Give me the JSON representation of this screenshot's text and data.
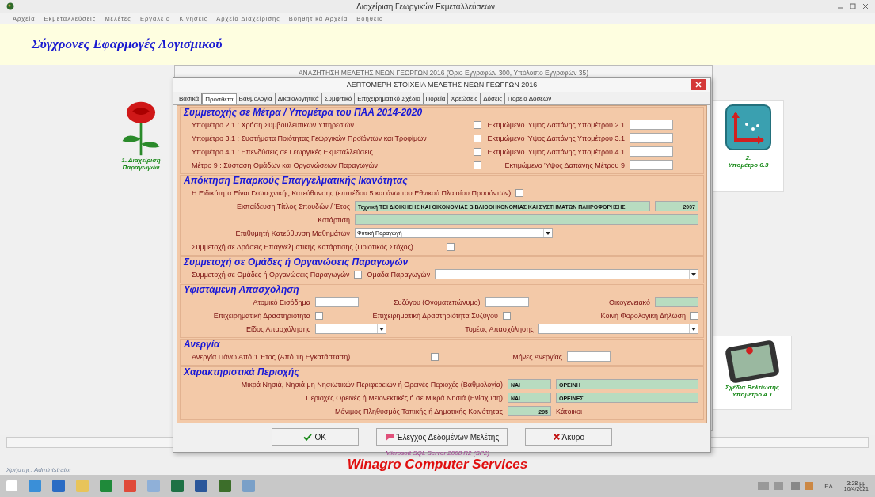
{
  "app": {
    "title": "Διαχείριση Γεωργικών Εκμεταλλεύσεων",
    "menu": [
      "Αρχεία",
      "Εκμεταλλεύσεις",
      "Μελέτες",
      "Εργαλεία",
      "Κινήσεις",
      "Αρχεία Διαχείρισης",
      "Βοηθητικά Αρχεία",
      "Βοήθεια"
    ],
    "brand": "Σύγχρονες Εφαρμογές Λογισμικού"
  },
  "cards": [
    {
      "kind": "rose",
      "label": "1. Διαχείριση",
      "sublabel": "Παραγωγών"
    },
    {
      "kind": "chart",
      "label": "2.",
      "sublabel": "Υπομέτρο 6.3"
    },
    {
      "kind": "phone",
      "label": "Σχέδια Βελτίωσης",
      "sublabel": "Υπομέτρο 4.1"
    }
  ],
  "background_window": {
    "title": "ΑΝΑΖΗΤΗΣΗ ΜΕΛΕΤΗΣ ΝΕΩΝ ΓΕΩΡΓΩΝ 2016 (Όριο Εγγραφών 300, Υπόλοιπο Εγγραφών 35)"
  },
  "dialog": {
    "title": "ΛΕΠΤΟΜΕΡΗ ΣΤΟΙΧΕΙΑ ΜΕΛΕΤΗΣ ΝΕΩΝ ΓΕΩΡΓΩΝ 2016",
    "tabs": [
      {
        "label": "Βασικά",
        "selected": false
      },
      {
        "label": "Πρόσθετα",
        "selected": true
      },
      {
        "label": "Βαθμολογία",
        "selected": false
      },
      {
        "label": "Δικαιολογητικά",
        "selected": false
      },
      {
        "label": "Συμφ/τικό",
        "selected": false
      },
      {
        "label": "Επιχειρηματικό Σχέδιο",
        "selected": false
      },
      {
        "label": "Πορεία",
        "selected": false
      },
      {
        "label": "Χρεώσεις",
        "selected": false
      },
      {
        "label": "Δόσεις",
        "selected": false
      },
      {
        "label": "Πορεία Δόσεων",
        "selected": false
      }
    ],
    "measures": {
      "title": "Συμμετοχής σε Μέτρα / Υπομέτρα του ΠΑΑ 2014-2020",
      "items": [
        {
          "label": "Υπομέτρο 2.1 : Χρήση Συμβουλευτικών Υπηρεσιών",
          "checked": false,
          "cost_label": "Εκτιμώμενο Ύψος Δαπάνης Υπομέτρου 2.1"
        },
        {
          "label": "Υπομέτρο 3.1 : Συστήματα Ποιότητας Γεωργικών Προϊόντων και Τροφίμων",
          "checked": false,
          "cost_label": "Εκτιμώμενο Ύψος Δαπάνης Υπομέτρου 3.1"
        },
        {
          "label": "Υπομέτρο 4.1 : Επενδύσεις σε Γεωργικές Εκμεταλλεύσεις",
          "checked": false,
          "cost_label": "Εκτιμώμενο Ύψος Δαπάνης Υπομέτρου 4.1"
        },
        {
          "label": "Μέτρο 9 : Σύσταση Ομάδων και Οργανώσεων Παραγωγών",
          "checked": false,
          "cost_label": "Εκτιμώμενο Ύψος Δαπάνης Μέτρου 9"
        }
      ]
    },
    "competence": {
      "title": "Απόκτηση Επαρκούς Επαγγελματικής Ικανότητας",
      "geotech": {
        "label": "Η Ειδικότητα Είναι Γεωτεχνικής Κατεύθυνσης  (επιπέδου 5 και άνω του Εθνικού Πλαισίου Προσόντων)",
        "checked": false
      },
      "education": {
        "label": "Εκπαίδευση Τίτλος Σπουδών / Έτος",
        "value": "Τεχνική ΤΕΙ ΔΙΟΙΚΗΣΗΣ ΚΑΙ ΟΙΚΟΝΟΜΙΑΣ ΒΙΒΛΙΟΘΗΚΟΝΟΜΙΑΣ ΚΑΙ ΣΥΣΤΗΜΑΤΩΝ ΠΛΗΡΟΦΟΡΗΣΗΣ",
        "year": "2007"
      },
      "training": {
        "label": "Κατάρτιση"
      },
      "course": {
        "label": "Επιθυμητή Κατεύθυνση Μαθημάτων",
        "value": "Φυτική Παραγωγή"
      },
      "participation": {
        "label": "Συμμετοχή σε Δράσεις Επαγγελματικής Κατάρτισης (Ποιοτικός Στόχος)",
        "checked": false
      }
    },
    "groups": {
      "title": "Συμμετοχή σε Ομάδες ή Οργανώσεις Παραγωγών",
      "participation": {
        "label": "Συμμετοχή σε Ομάδες ή Οργανώσεις Παραγωγών",
        "checked": false
      },
      "group_label": "Ομάδα Παραγωγών"
    },
    "employment": {
      "title": "Υφιστάμενη Απασχόληση",
      "income_label": "Ατομικό Εισόδημα",
      "spouse_label": "Συζύγου (Ονοματεπώνυμο)",
      "family_label": "Οικογενειακό",
      "business": {
        "label": "Επιχειρηματική Δραστηριότητα",
        "checked": false
      },
      "spouse_business": {
        "label": "Επιχειρηματική Δραστηριότητα Συζύγου",
        "checked": false
      },
      "joint_tax": {
        "label": "Κοινή Φορολογική Δήλωση",
        "checked": false
      },
      "type_label": "Είδος Απασχόλησης",
      "sector_label": "Τομέας Απασχόλησης"
    },
    "unemployment": {
      "title": "Ανεργία",
      "long_term": {
        "label": "Ανεργία Πάνω Από 1 Έτος (Από 1η Εγκατάσταση)",
        "checked": false
      },
      "months_label": "Μήνες Ανεργίας"
    },
    "area": {
      "title": "Χαρακτηριστικά Περιοχής",
      "rows": [
        {
          "label": "Μικρά Νησιά, Νησιά μη Νησιωτικών Περιφερειών ή Ορεινές Περιοχές (Βαθμολογία)",
          "flag": "ΝΑΙ",
          "value": "ΟΡΕΙΝΗ"
        },
        {
          "label": "Περιοχές Ορεινές ή Μειονεκτικές ή σε Μικρά Νησιά (Ενίσχυση)",
          "flag": "ΝΑΙ",
          "value": "ΟΡΕΙΝΕΣ"
        }
      ],
      "population": {
        "label": "Μόνιμος Πληθυσμός Τοπικής ή Δημοτικής Κοινότητας",
        "value": "295",
        "unit": "Κάτοικοι"
      }
    },
    "buttons": [
      {
        "kind": "ok",
        "label": "OK"
      },
      {
        "kind": "check",
        "label": "Έλεγχος Δεδομένων Μελέτης"
      },
      {
        "kind": "cancel",
        "label": "Άκυρο"
      }
    ]
  },
  "status": {
    "user": "Χρήστης: Administrator",
    "server": "Microsoft SQL Server 2008 R2 (SP2)",
    "company": "Winagro Computer Services"
  },
  "taskbar": {
    "language": "ΕΛ",
    "time": "3:28 μμ",
    "date": "10/4/2021"
  }
}
